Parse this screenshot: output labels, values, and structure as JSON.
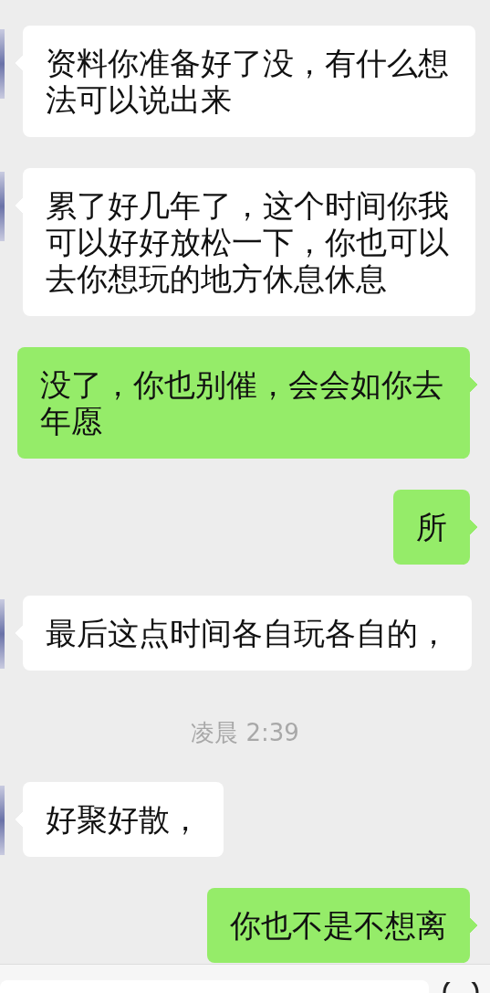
{
  "messages": [
    {
      "kind": "incoming",
      "text": "资料你准备好了没，有什么想法可以说出来"
    },
    {
      "kind": "incoming",
      "text": "累了好几年了，这个时间你我可以好好放松一下，你也可以去你想玩的地方休息休息"
    },
    {
      "kind": "outgoing",
      "text": "没了，你也别催，会会如你去年愿"
    },
    {
      "kind": "outgoing",
      "text": "所"
    },
    {
      "kind": "incoming",
      "text": "最后这点时间各自玩各自的，"
    },
    {
      "kind": "time",
      "text": "凌晨 2:39"
    },
    {
      "kind": "incoming",
      "text": "好聚好散，"
    },
    {
      "kind": "outgoing",
      "text": "你也不是不想离"
    }
  ]
}
